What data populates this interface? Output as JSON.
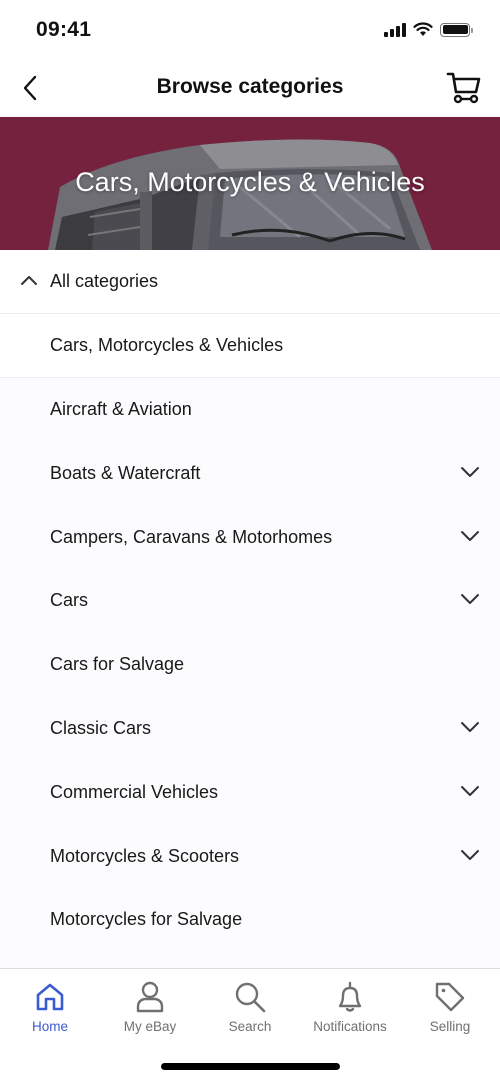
{
  "status_bar": {
    "time": "09:41",
    "icons": [
      "cellular-signal-icon",
      "wifi-icon",
      "battery-icon"
    ]
  },
  "nav": {
    "title": "Browse categories",
    "back_icon": "chevron-left-icon",
    "cart_icon": "shopping-cart-icon"
  },
  "banner": {
    "title": "Cars, Motorcycles & Vehicles",
    "background_color": "#74223e"
  },
  "breadcrumb": {
    "all_categories_label": "All categories",
    "all_categories_icon": "chevron-up-icon",
    "current_category": "Cars, Motorcycles & Vehicles"
  },
  "categories": [
    {
      "label": "Aircraft & Aviation",
      "expandable": false
    },
    {
      "label": "Boats & Watercraft",
      "expandable": true
    },
    {
      "label": "Campers, Caravans & Motorhomes",
      "expandable": true
    },
    {
      "label": "Cars",
      "expandable": true
    },
    {
      "label": "Cars for Salvage",
      "expandable": false
    },
    {
      "label": "Classic Cars",
      "expandable": true
    },
    {
      "label": "Commercial Vehicles",
      "expandable": true
    },
    {
      "label": "Motorcycles & Scooters",
      "expandable": true
    },
    {
      "label": "Motorcycles for Salvage",
      "expandable": false
    }
  ],
  "tab_bar": {
    "active_color": "#3b5bd0",
    "inactive_color": "#707070",
    "tabs": [
      {
        "label": "Home",
        "icon": "home-icon",
        "active": true
      },
      {
        "label": "My eBay",
        "icon": "user-icon",
        "active": false
      },
      {
        "label": "Search",
        "icon": "search-icon",
        "active": false
      },
      {
        "label": "Notifications",
        "icon": "bell-icon",
        "active": false
      },
      {
        "label": "Selling",
        "icon": "tag-icon",
        "active": false
      }
    ]
  }
}
